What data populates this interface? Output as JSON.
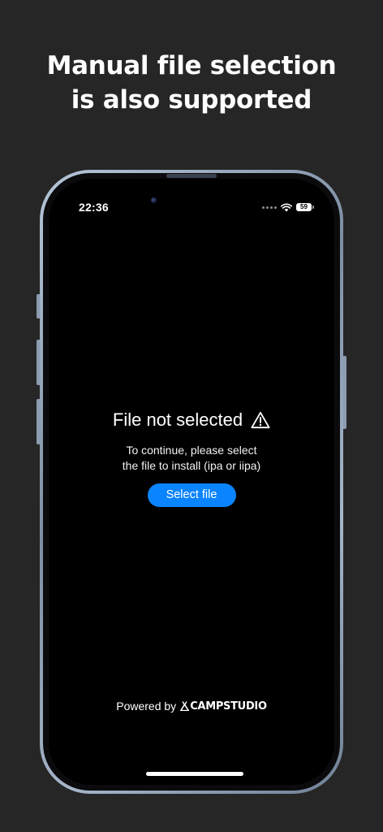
{
  "headline": {
    "line1": "Manual file selection",
    "line2": "is also supported"
  },
  "status_bar": {
    "time": "22:36",
    "battery_level": "59",
    "icons": [
      "signal-dots-icon",
      "wifi-icon",
      "battery-icon"
    ]
  },
  "empty_state": {
    "title": "File not selected",
    "title_icon": "warning-triangle-icon",
    "description_line1": "To continue, please select",
    "description_line2": "the file to install (ipa or iipa)",
    "button_label": "Select file"
  },
  "footer": {
    "powered_by": "Powered by",
    "brand_name": "CAMPSTUDIO",
    "brand_icon": "tent-logo-icon"
  },
  "colors": {
    "page_background": "#262626",
    "screen_background": "#000000",
    "accent": "#0a84ff",
    "text": "#ffffff"
  }
}
